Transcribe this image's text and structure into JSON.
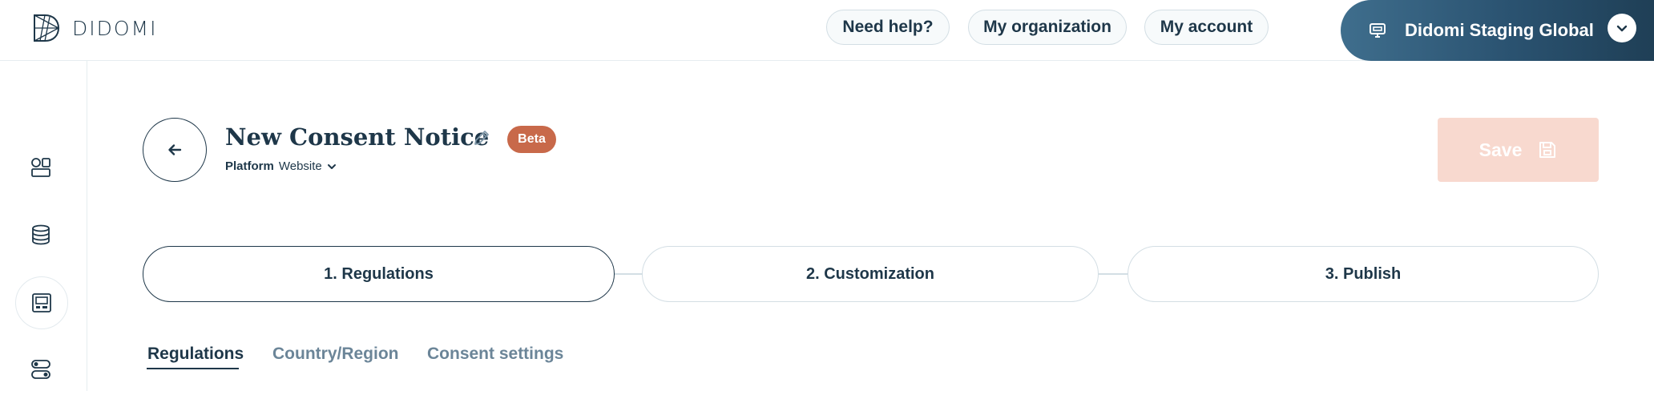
{
  "header": {
    "logo_text": "DIDOMI",
    "help_label": "Need help?",
    "organization_label": "My organization",
    "account_label": "My account",
    "org_switcher_label": "Didomi Staging Global"
  },
  "sidebar": {
    "items": [
      {
        "icon": "dashboard-icon",
        "active": false
      },
      {
        "icon": "database-icon",
        "active": false
      },
      {
        "icon": "consent-notice-icon",
        "active": true
      },
      {
        "icon": "toggles-icon",
        "active": false
      }
    ]
  },
  "notice": {
    "title": "New Consent Notice",
    "badge": "Beta",
    "platform_label": "Platform",
    "platform_value": "Website"
  },
  "actions": {
    "save_label": "Save"
  },
  "steps": [
    {
      "label": "1. Regulations",
      "active": true
    },
    {
      "label": "2. Customization",
      "active": false
    },
    {
      "label": "3. Publish",
      "active": false
    }
  ],
  "tabs": [
    {
      "label": "Regulations",
      "active": true
    },
    {
      "label": "Country/Region",
      "active": false
    },
    {
      "label": "Consent settings",
      "active": false
    }
  ],
  "colors": {
    "primary": "#1e3749",
    "beta": "#c8694a",
    "save_disabled": "#f8d9cf",
    "border": "#d3dee4"
  }
}
